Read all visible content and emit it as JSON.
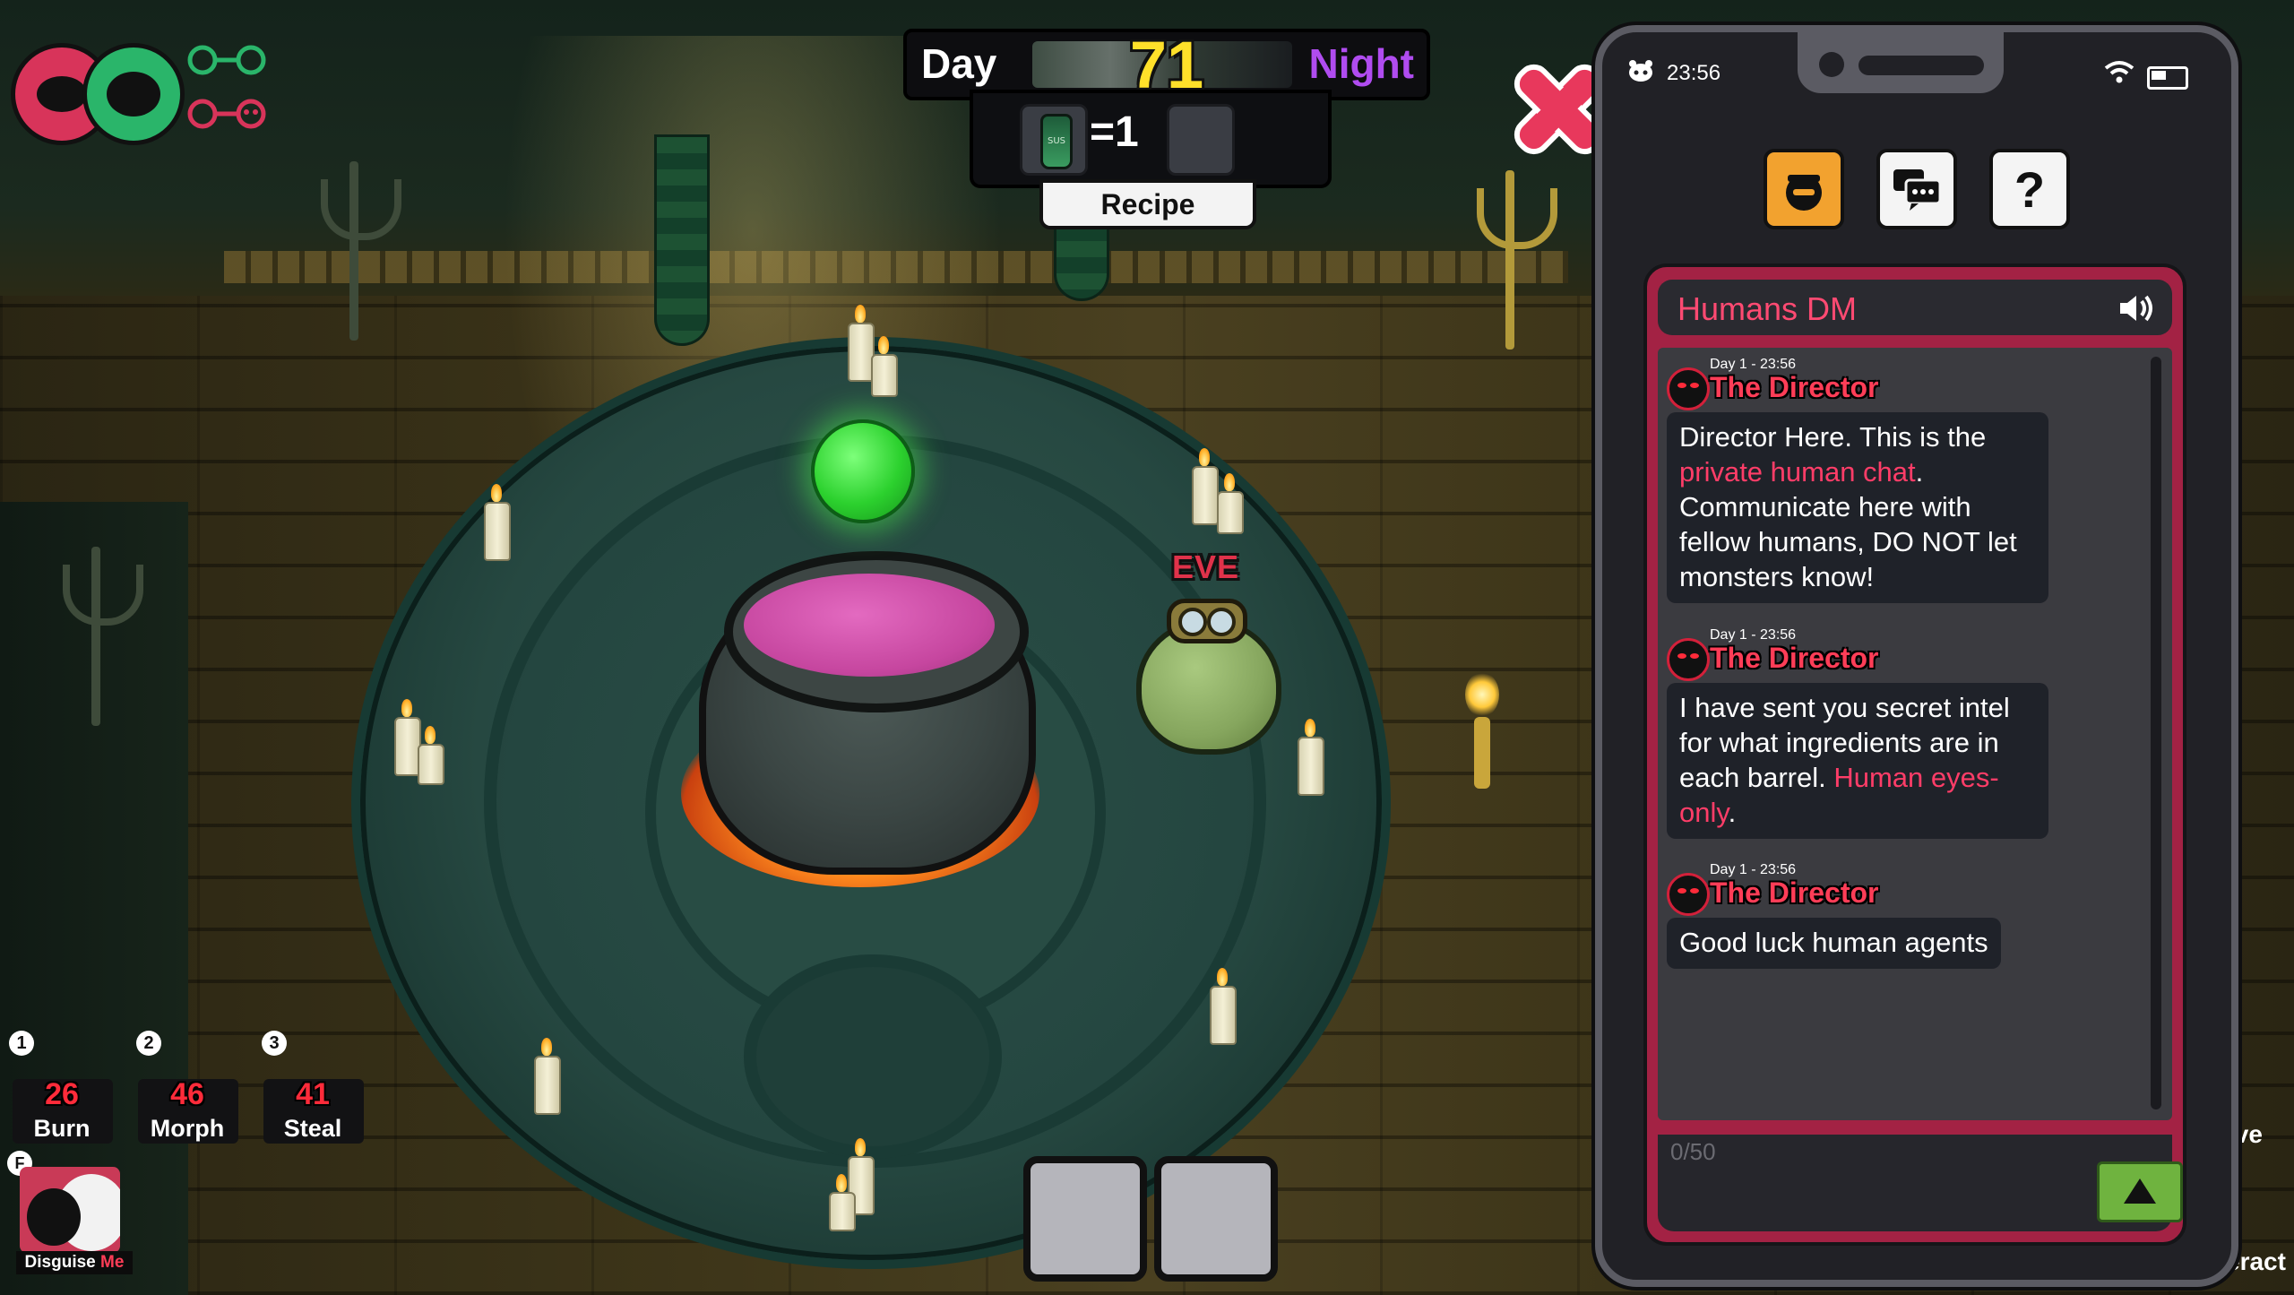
{
  "hud": {
    "day_label": "Day",
    "day_number": "71",
    "night_label": "Night",
    "recipe_count": "=1",
    "recipe_button": "Recipe",
    "bottle_label": "SUS"
  },
  "character": {
    "name": "EVE"
  },
  "abilities": [
    {
      "key": "1",
      "cooldown": "26",
      "name": "Burn"
    },
    {
      "key": "2",
      "cooldown": "46",
      "name": "Morph"
    },
    {
      "key": "3",
      "cooldown": "41",
      "name": "Steal"
    }
  ],
  "disguise": {
    "key": "F",
    "label_main": "Disguise ",
    "label_accent": "Me"
  },
  "right_edge": {
    "top_label": "ive",
    "bottom_label": "eract"
  },
  "phone": {
    "status_time": "23:56",
    "chat": {
      "title": "Humans DM",
      "char_counter": "0/50",
      "messages": [
        {
          "meta": "Day 1 - 23:56",
          "sender": "The Director",
          "parts": [
            {
              "t": "Director Here. This is the "
            },
            {
              "t": "private human chat",
              "hl": true
            },
            {
              "t": ". Communicate here with fellow humans, DO NOT let monsters know!"
            }
          ]
        },
        {
          "meta": "Day 1 - 23:56",
          "sender": "The Director",
          "parts": [
            {
              "t": "I have sent you secret intel for what ingredients are in each barrel. "
            },
            {
              "t": "Human eyes-only",
              "hl": true
            },
            {
              "t": "."
            }
          ]
        },
        {
          "meta": "Day 1 - 23:56",
          "sender": "The Director",
          "parts": [
            {
              "t": "Good luck human agents"
            }
          ]
        }
      ]
    }
  },
  "colors": {
    "human_team": "#d8345a",
    "monster_team": "#2ab56a",
    "day_number": "#ffe02a",
    "night": "#b04cf0",
    "accent_red": "#ff3d57",
    "send_button": "#6fb33f"
  },
  "icons": {
    "close": "close-x-icon",
    "identity_tab": "spy-icon",
    "chat_tab": "chat-bubbles-icon",
    "help_tab": "question-icon",
    "sound": "speaker-icon",
    "send": "send-arrow-icon"
  }
}
